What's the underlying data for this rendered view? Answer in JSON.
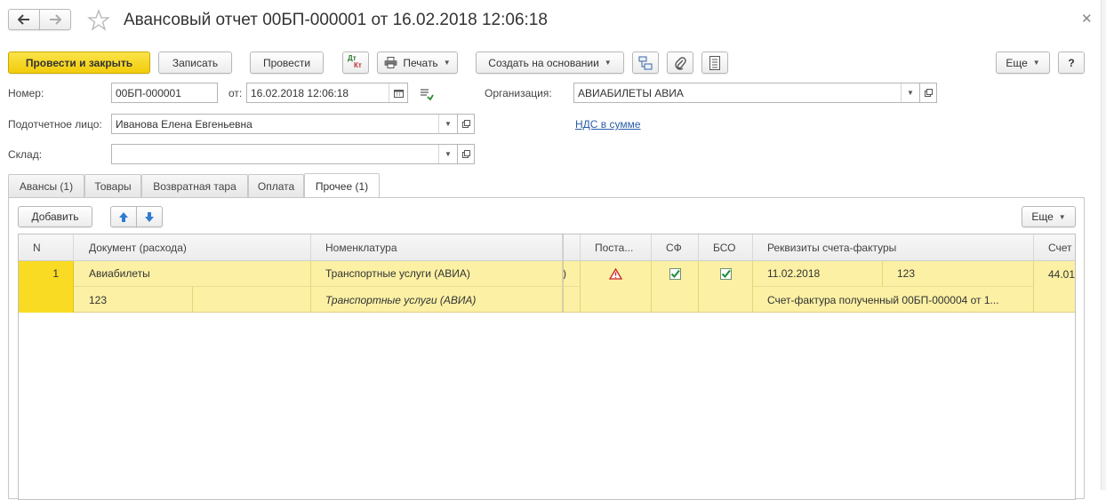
{
  "window": {
    "title": "Авансовый отчет 00БП-000001 от 16.02.2018 12:06:18"
  },
  "toolbar": {
    "post_close": "Провести и закрыть",
    "save": "Записать",
    "post": "Провести",
    "print": "Печать",
    "create_based": "Создать на основании",
    "more": "Еще",
    "help": "?",
    "dtkt_top": "Дт",
    "dtkt_bottom": "Кт"
  },
  "form": {
    "number_label": "Номер:",
    "number_value": "00БП-000001",
    "date_label": "от:",
    "date_value": "16.02.2018 12:06:18",
    "org_label": "Организация:",
    "org_value": "АВИАБИЛЕТЫ АВИА",
    "person_label": "Подотчетное лицо:",
    "person_value": "Иванова Елена Евгеньевна",
    "vat_link": "НДС в сумме",
    "warehouse_label": "Склад:",
    "warehouse_value": ""
  },
  "tabs": [
    {
      "label": "Авансы (1)"
    },
    {
      "label": "Товары"
    },
    {
      "label": "Возвратная тара"
    },
    {
      "label": "Оплата"
    },
    {
      "label": "Прочее (1)"
    }
  ],
  "panel": {
    "add": "Добавить",
    "more": "Еще"
  },
  "table": {
    "headers": {
      "n": "N",
      "doc": "Документ (расхода)",
      "nomen": "Номенклатура",
      "supplier": "Поста...",
      "sf": "СФ",
      "bso": "БСО",
      "invoice": "Реквизиты счета-фактуры",
      "account": "Счет"
    },
    "row1": {
      "n": "1",
      "doc": "Авиабилеты",
      "nomen": "Транспортные услуги (АВИА)",
      "partial": ")",
      "invoice_date": "11.02.2018",
      "invoice_num": "123",
      "account": "44.01",
      "sf_checked": true,
      "bso_checked": true
    },
    "row2": {
      "doc": "123",
      "nomen": "Транспортные услуги (АВИА)",
      "invoice": "Счет-фактура полученный 00БП-000004 от 1..."
    }
  },
  "colors": {
    "primary_button": "#f5d31c",
    "selected_row": "#fbf0a4",
    "selected_cell": "#f9db24",
    "link": "#2a5da8"
  }
}
